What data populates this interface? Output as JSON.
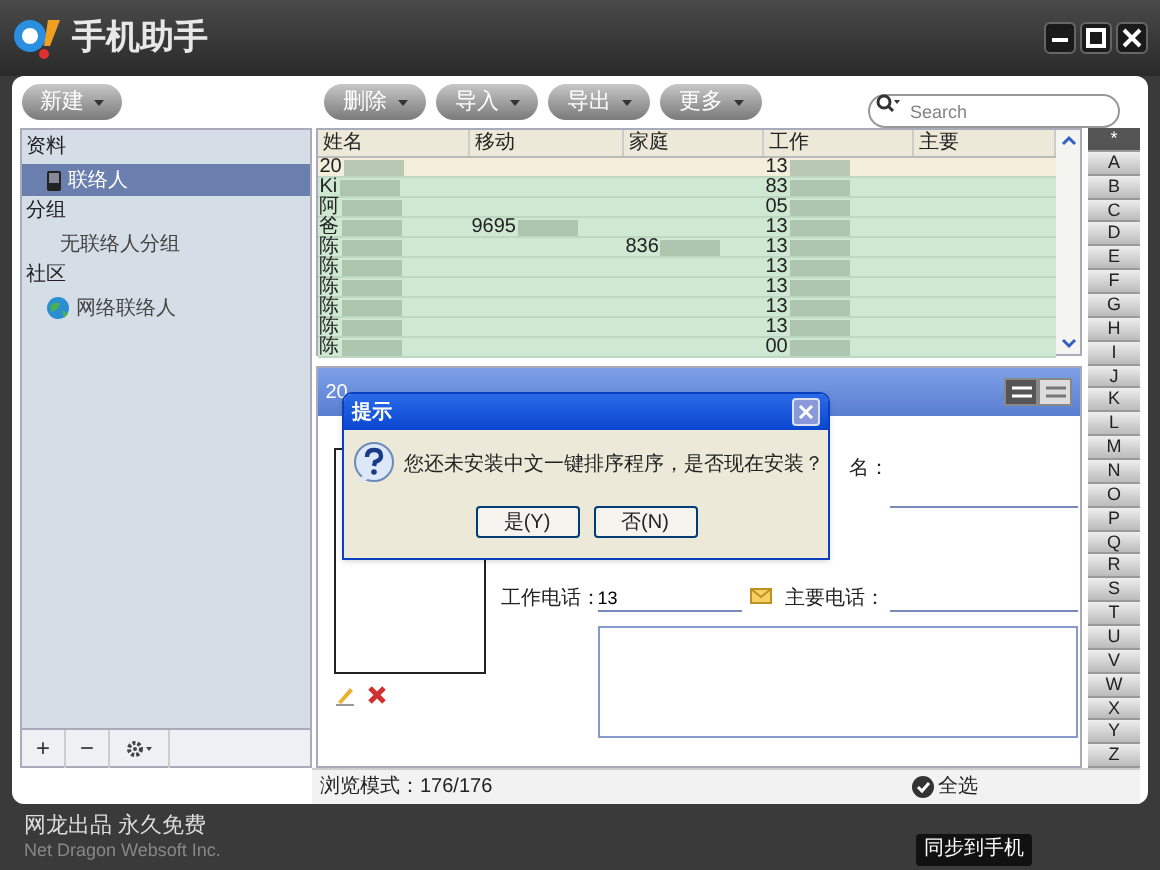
{
  "window": {
    "title": "手机助手"
  },
  "toolbar": {
    "new_button": "新建",
    "buttons": [
      "删除",
      "导入",
      "导出",
      "更多"
    ],
    "search": {
      "placeholder": "Search"
    }
  },
  "sidebar": {
    "sections": [
      {
        "title": "资料",
        "items": [
          {
            "label": "联络人",
            "kind": "phone",
            "selected": true
          }
        ]
      },
      {
        "title": "分组",
        "items": [
          {
            "label": "无联络人分组",
            "kind": "plain",
            "selected": false
          }
        ]
      },
      {
        "title": "社区",
        "items": [
          {
            "label": "网络联络人",
            "kind": "globe",
            "selected": false
          }
        ]
      }
    ],
    "tools": [
      "+",
      "−"
    ]
  },
  "table": {
    "columns": [
      "姓名",
      "移动",
      "家庭",
      "工作",
      "主要"
    ],
    "rows": [
      {
        "selected": true,
        "name": "20",
        "work": "13"
      },
      {
        "selected": false,
        "name": "Ki",
        "work": "83"
      },
      {
        "selected": false,
        "name": "阿",
        "work": "05"
      },
      {
        "selected": false,
        "name": "爸",
        "mobile": "9695",
        "work": "13"
      },
      {
        "selected": false,
        "name": "陈",
        "home": "836",
        "work": "13"
      },
      {
        "selected": false,
        "name": "陈",
        "work": "13"
      },
      {
        "selected": false,
        "name": "陈",
        "work": "13"
      },
      {
        "selected": false,
        "name": "陈",
        "work": "13"
      },
      {
        "selected": false,
        "name": "陈",
        "work": "13"
      },
      {
        "selected": false,
        "name": "陈",
        "work": "00"
      }
    ]
  },
  "alphabet": [
    {
      "label": "*",
      "selected": true
    },
    {
      "label": "A",
      "selected": false
    },
    {
      "label": "B",
      "selected": false
    },
    {
      "label": "C",
      "selected": false
    },
    {
      "label": "D",
      "selected": false
    },
    {
      "label": "E",
      "selected": false
    },
    {
      "label": "F",
      "selected": false
    },
    {
      "label": "G",
      "selected": false
    },
    {
      "label": "H",
      "selected": false
    },
    {
      "label": "I",
      "selected": false
    },
    {
      "label": "J",
      "selected": false
    },
    {
      "label": "K",
      "selected": false
    },
    {
      "label": "L",
      "selected": false
    },
    {
      "label": "M",
      "selected": false
    },
    {
      "label": "N",
      "selected": false
    },
    {
      "label": "O",
      "selected": false
    },
    {
      "label": "P",
      "selected": false
    },
    {
      "label": "Q",
      "selected": false
    },
    {
      "label": "R",
      "selected": false
    },
    {
      "label": "S",
      "selected": false
    },
    {
      "label": "T",
      "selected": false
    },
    {
      "label": "U",
      "selected": false
    },
    {
      "label": "V",
      "selected": false
    },
    {
      "label": "W",
      "selected": false
    },
    {
      "label": "X",
      "selected": false
    },
    {
      "label": "Y",
      "selected": false
    },
    {
      "label": "Z",
      "selected": false
    }
  ],
  "detail": {
    "header": "20",
    "view_toggle": [
      {
        "selected": true
      },
      {
        "selected": false
      }
    ],
    "fields": [
      {
        "label": "名："
      },
      {
        "label": "工作电话：",
        "value": "13"
      },
      {
        "label": "主要电话："
      }
    ]
  },
  "dialog": {
    "title": "提示",
    "message": "您还未安装中文一键排序程序，是否现在安装？",
    "buttons": [
      "是(Y)",
      "否(N)"
    ]
  },
  "status": {
    "mode": "浏览模式：176/176",
    "select_all": "全选"
  },
  "footer": {
    "line_1": "网龙出品 永久免费",
    "line_2": "Net Dragon Websoft Inc.",
    "sync_button": "同步到手机"
  }
}
